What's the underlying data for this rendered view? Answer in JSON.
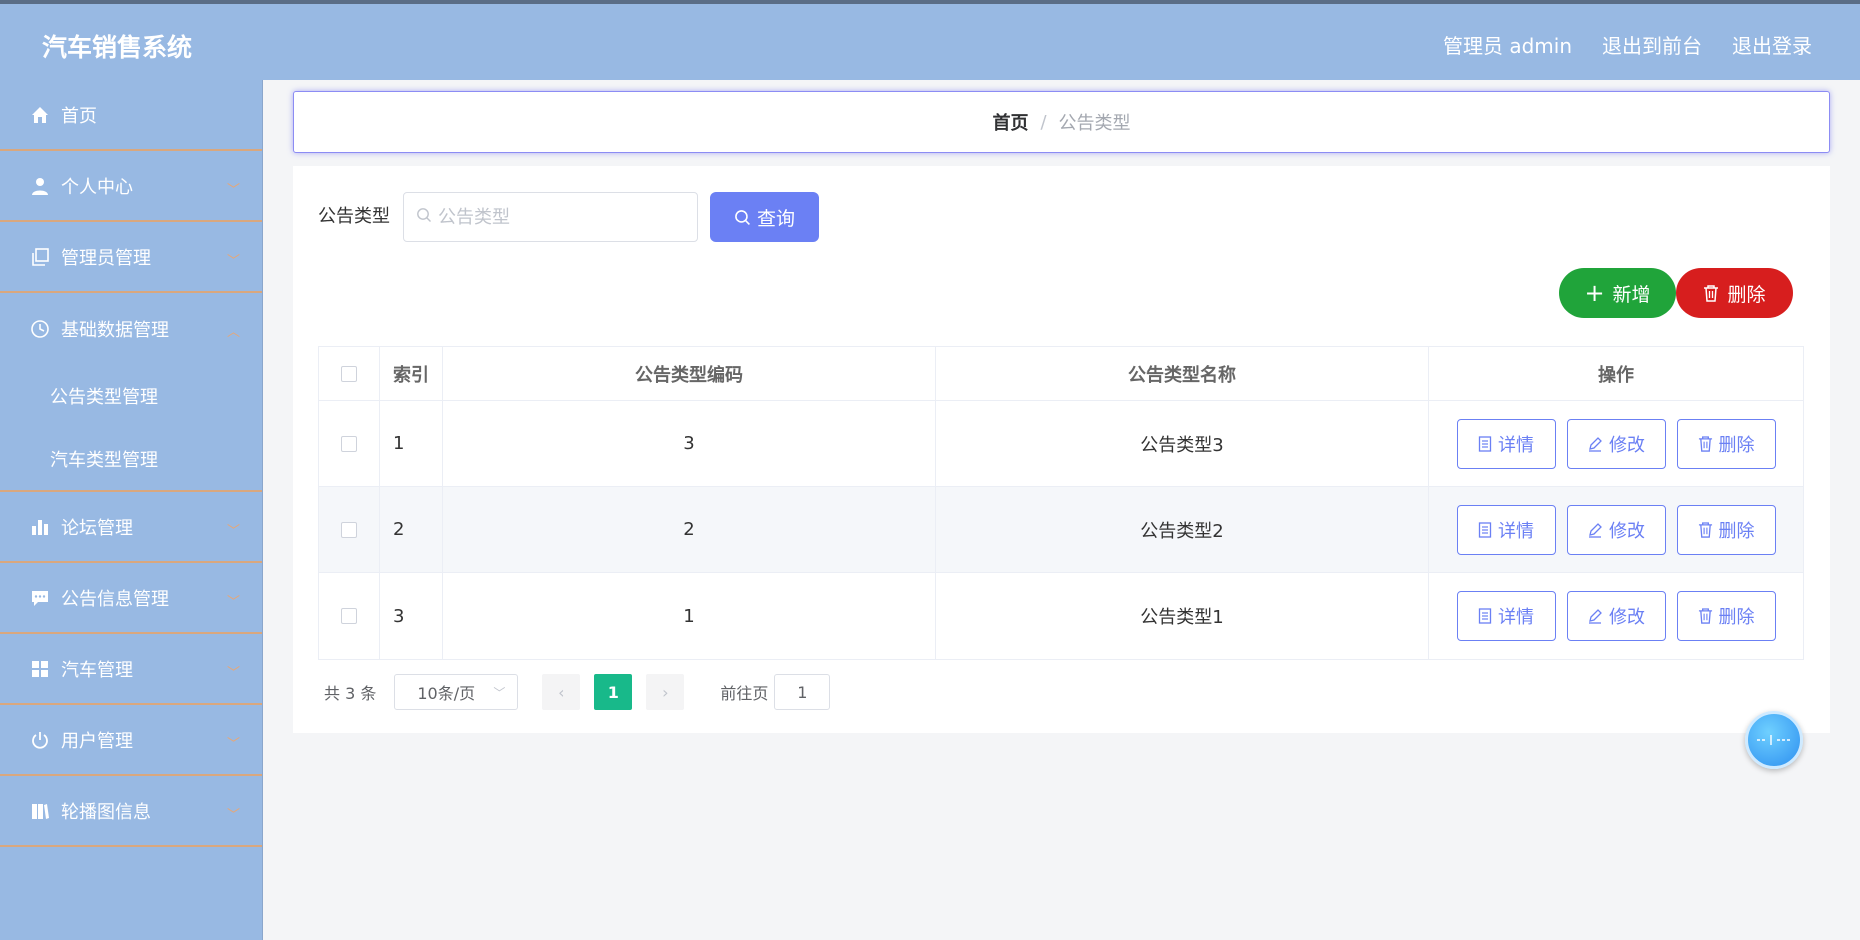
{
  "app": {
    "title": "汽车销售系统"
  },
  "header": {
    "user_label": "管理员 admin",
    "to_front": "退出到前台",
    "logout": "退出登录"
  },
  "sidebar": {
    "items": [
      {
        "label": "首页",
        "icon": "home-icon"
      },
      {
        "label": "个人中心",
        "icon": "person-icon"
      },
      {
        "label": "管理员管理",
        "icon": "copy-icon"
      },
      {
        "label": "基础数据管理",
        "icon": "clock-icon"
      },
      {
        "label": "论坛管理",
        "icon": "bar-chart-icon"
      },
      {
        "label": "公告信息管理",
        "icon": "chat-icon"
      },
      {
        "label": "汽车管理",
        "icon": "grid-icon"
      },
      {
        "label": "用户管理",
        "icon": "power-icon"
      },
      {
        "label": "轮播图信息",
        "icon": "book-icon"
      }
    ],
    "sub_items": [
      {
        "label": "公告类型管理"
      },
      {
        "label": "汽车类型管理"
      }
    ]
  },
  "breadcrumb": {
    "home": "首页",
    "sep": "/",
    "current": "公告类型"
  },
  "search": {
    "label": "公告类型",
    "placeholder": "公告类型",
    "button": "查询"
  },
  "actions": {
    "add": "新增",
    "delete": "删除"
  },
  "table": {
    "headers": {
      "index": "索引",
      "code": "公告类型编码",
      "name": "公告类型名称",
      "ops": "操作"
    },
    "rows": [
      {
        "index": "1",
        "code": "3",
        "name": "公告类型3"
      },
      {
        "index": "2",
        "code": "2",
        "name": "公告类型2"
      },
      {
        "index": "3",
        "code": "1",
        "name": "公告类型1"
      }
    ],
    "row_actions": {
      "detail": "详情",
      "edit": "修改",
      "delete": "删除"
    }
  },
  "pagination": {
    "total": "共 3 条",
    "page_size": "10条/页",
    "current_page": "1",
    "goto_label": "前往页",
    "goto_value": "1"
  },
  "colors": {
    "header_bg": "#98b9e3",
    "accent": "#6b80f4",
    "success": "#20a43a",
    "danger": "#d71e1e",
    "page_active": "#18b98a"
  }
}
